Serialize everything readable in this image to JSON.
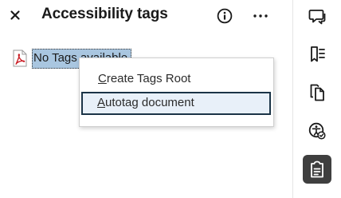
{
  "panel": {
    "title": "Accessibility tags",
    "close_icon": "close-icon",
    "info_icon": "info-icon",
    "more_icon": "more-options-icon"
  },
  "tree": {
    "root_icon": "pdf-file-icon",
    "root_label": "No Tags available"
  },
  "context_menu": {
    "items": [
      {
        "label_prefix": "C",
        "label_rest": "reate Tags Root",
        "highlighted": false
      },
      {
        "label_prefix": "A",
        "label_rest": "utotag document",
        "highlighted": true
      }
    ]
  },
  "rail": {
    "items": [
      {
        "icon": "comment-icon",
        "active": false
      },
      {
        "icon": "bookmark-list-icon",
        "active": false
      },
      {
        "icon": "pages-icon",
        "active": false
      },
      {
        "icon": "accessibility-icon",
        "active": false
      },
      {
        "icon": "tags-icon",
        "active": true
      }
    ]
  },
  "colors": {
    "selection": "#a9c6e0",
    "menu_highlight": "#e8f0f9",
    "focus_border": "#1b3447",
    "pdf_red": "#c8161e",
    "rail_active": "#3f3f3f"
  }
}
